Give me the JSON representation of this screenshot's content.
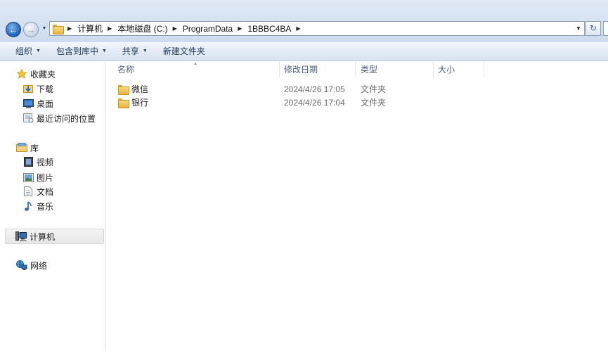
{
  "address": {
    "breadcrumbs": [
      "计算机",
      "本地磁盘 (C:)",
      "ProgramData",
      "1BBBC4BA"
    ]
  },
  "toolbar": {
    "organize": "组织",
    "include_in_library": "包含到库中",
    "share": "共享",
    "new_folder": "新建文件夹"
  },
  "nav": {
    "favorites": "收藏夹",
    "downloads": "下载",
    "desktop": "桌面",
    "recent": "最近访问的位置",
    "libraries": "库",
    "videos": "视频",
    "pictures": "图片",
    "documents": "文档",
    "music": "音乐",
    "computer": "计算机",
    "network": "网络"
  },
  "columns": {
    "name": "名称",
    "date_modified": "修改日期",
    "type": "类型",
    "size": "大小"
  },
  "files": [
    {
      "name": "微信",
      "date": "2024/4/26 17:05",
      "type": "文件夹"
    },
    {
      "name": "银行",
      "date": "2024/4/26 17:04",
      "type": "文件夹"
    }
  ],
  "colors": {
    "accent": "#2a6bc2",
    "toolbar_text": "#1e395b",
    "header_text": "#4c607a",
    "folder": "#f9d97d"
  }
}
